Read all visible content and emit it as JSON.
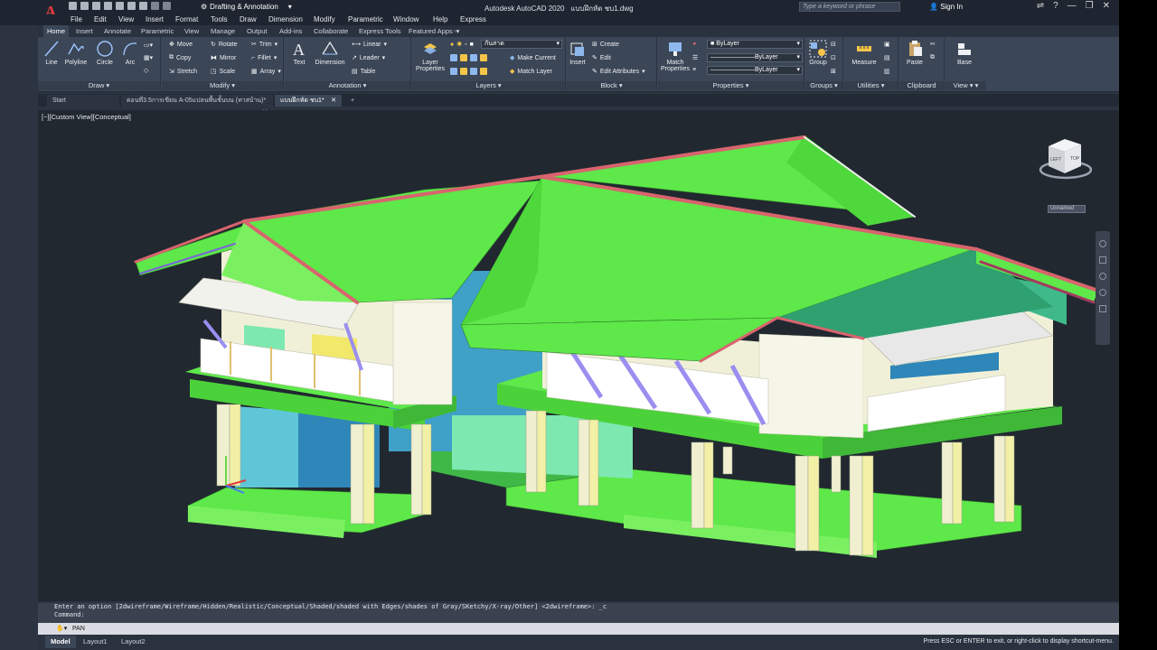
{
  "app": {
    "title": "Autodesk AutoCAD 2020",
    "file": "แบบฝึกหัด ชบ1.dwg",
    "workspace": "Drafting & Annotation",
    "search_placeholder": "Type a keyword or phrase",
    "sign_in": "Sign In"
  },
  "menu": [
    "File",
    "Edit",
    "View",
    "Insert",
    "Format",
    "Tools",
    "Draw",
    "Dimension",
    "Modify",
    "Parametric",
    "Window",
    "Help",
    "Express"
  ],
  "ribbon_tabs": [
    "Home",
    "Insert",
    "Annotate",
    "Parametric",
    "View",
    "Manage",
    "Output",
    "Add-ins",
    "Collaborate",
    "Express Tools",
    "Featured Apps"
  ],
  "ribbon": {
    "draw": {
      "title": "Draw",
      "line": "Line",
      "polyline": "Polyline",
      "circle": "Circle",
      "arc": "Arc"
    },
    "modify": {
      "title": "Modify",
      "move": "Move",
      "rotate": "Rotate",
      "trim": "Trim",
      "copy": "Copy",
      "mirror": "Mirror",
      "fillet": "Fillet",
      "stretch": "Stretch",
      "scale": "Scale",
      "array": "Array"
    },
    "annotation": {
      "title": "Annotation",
      "text": "Text",
      "dimension": "Dimension",
      "linear": "Linear",
      "leader": "Leader",
      "table": "Table"
    },
    "layers": {
      "title": "Layers",
      "layer_properties_1": "Layer",
      "layer_properties_2": "Properties",
      "current_layer": "กันสาด",
      "make_current": "Make Current",
      "match_layer": "Match Layer"
    },
    "block": {
      "title": "Block",
      "insert": "Insert",
      "create": "Create",
      "edit": "Edit",
      "edit_attributes": "Edit Attributes"
    },
    "properties": {
      "title": "Properties",
      "match_1": "Match",
      "match_2": "Properties",
      "color": "ByLayer",
      "linetype": "ByLayer",
      "lineweight": "ByLayer"
    },
    "groups": {
      "title": "Groups",
      "group": "Group"
    },
    "utilities": {
      "title": "Utilities",
      "measure": "Measure"
    },
    "clipboard": {
      "title": "Clipboard",
      "paste": "Paste"
    },
    "view": {
      "title": "View",
      "base": "Base"
    }
  },
  "file_tabs": [
    "Start",
    "ตอนที่3.5การเขียน A-05แปลนพื้นชั้นบน (ทาสบ้าน)*",
    "แบบฝึกหัด ชบ1*"
  ],
  "viewport_label": "[−][Custom View][Conceptual]",
  "viewcube": {
    "left": "LEFT",
    "top": "TOP",
    "named_view": "Unnamed"
  },
  "command": {
    "history_1": "Enter an option [2dwireframe/Wireframe/Hidden/Realistic/Conceptual/Shaded/shaded with Edges/shades of Gray/SKetchy/X-ray/Other] <2dwireframe>: _c",
    "history_2": "Command:",
    "current": "PAN"
  },
  "status": {
    "tabs": [
      "Model",
      "Layout1",
      "Layout2"
    ],
    "message": "Press ESC or ENTER to exit, or right-click to display shortcut-menu."
  },
  "colors": {
    "roof": "#5ee84a",
    "accent_red": "#e03b3b",
    "background": "#212830"
  }
}
